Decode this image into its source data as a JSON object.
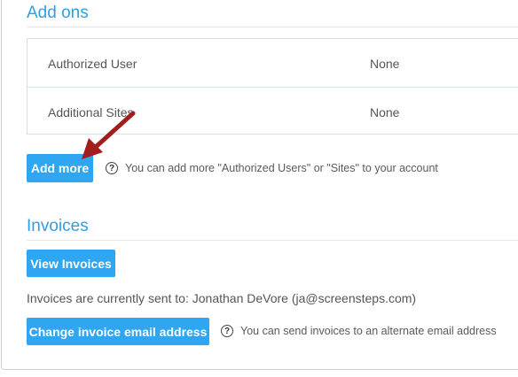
{
  "addons": {
    "title": "Add ons",
    "rows": [
      {
        "label": "Authorized User",
        "value": "None"
      },
      {
        "label": "Additional Sites",
        "value": "None"
      }
    ],
    "add_more_label": "Add more",
    "help_text": "You can add more \"Authorized Users\" or \"Sites\" to your account"
  },
  "invoices": {
    "title": "Invoices",
    "view_label": "View Invoices",
    "sent_to_text": "Invoices are currently sent to: Jonathan DeVore (ja@screensteps.com)",
    "change_email_label": "Change invoice email address",
    "help_text": "You can send invoices to an alternate email address"
  },
  "icons": {
    "help": "question-circle-icon",
    "annotation": "red-arrow-icon"
  },
  "colors": {
    "accent": "#2ea6f1",
    "title": "#2f9ee8",
    "arrow": "#a31d1d"
  }
}
